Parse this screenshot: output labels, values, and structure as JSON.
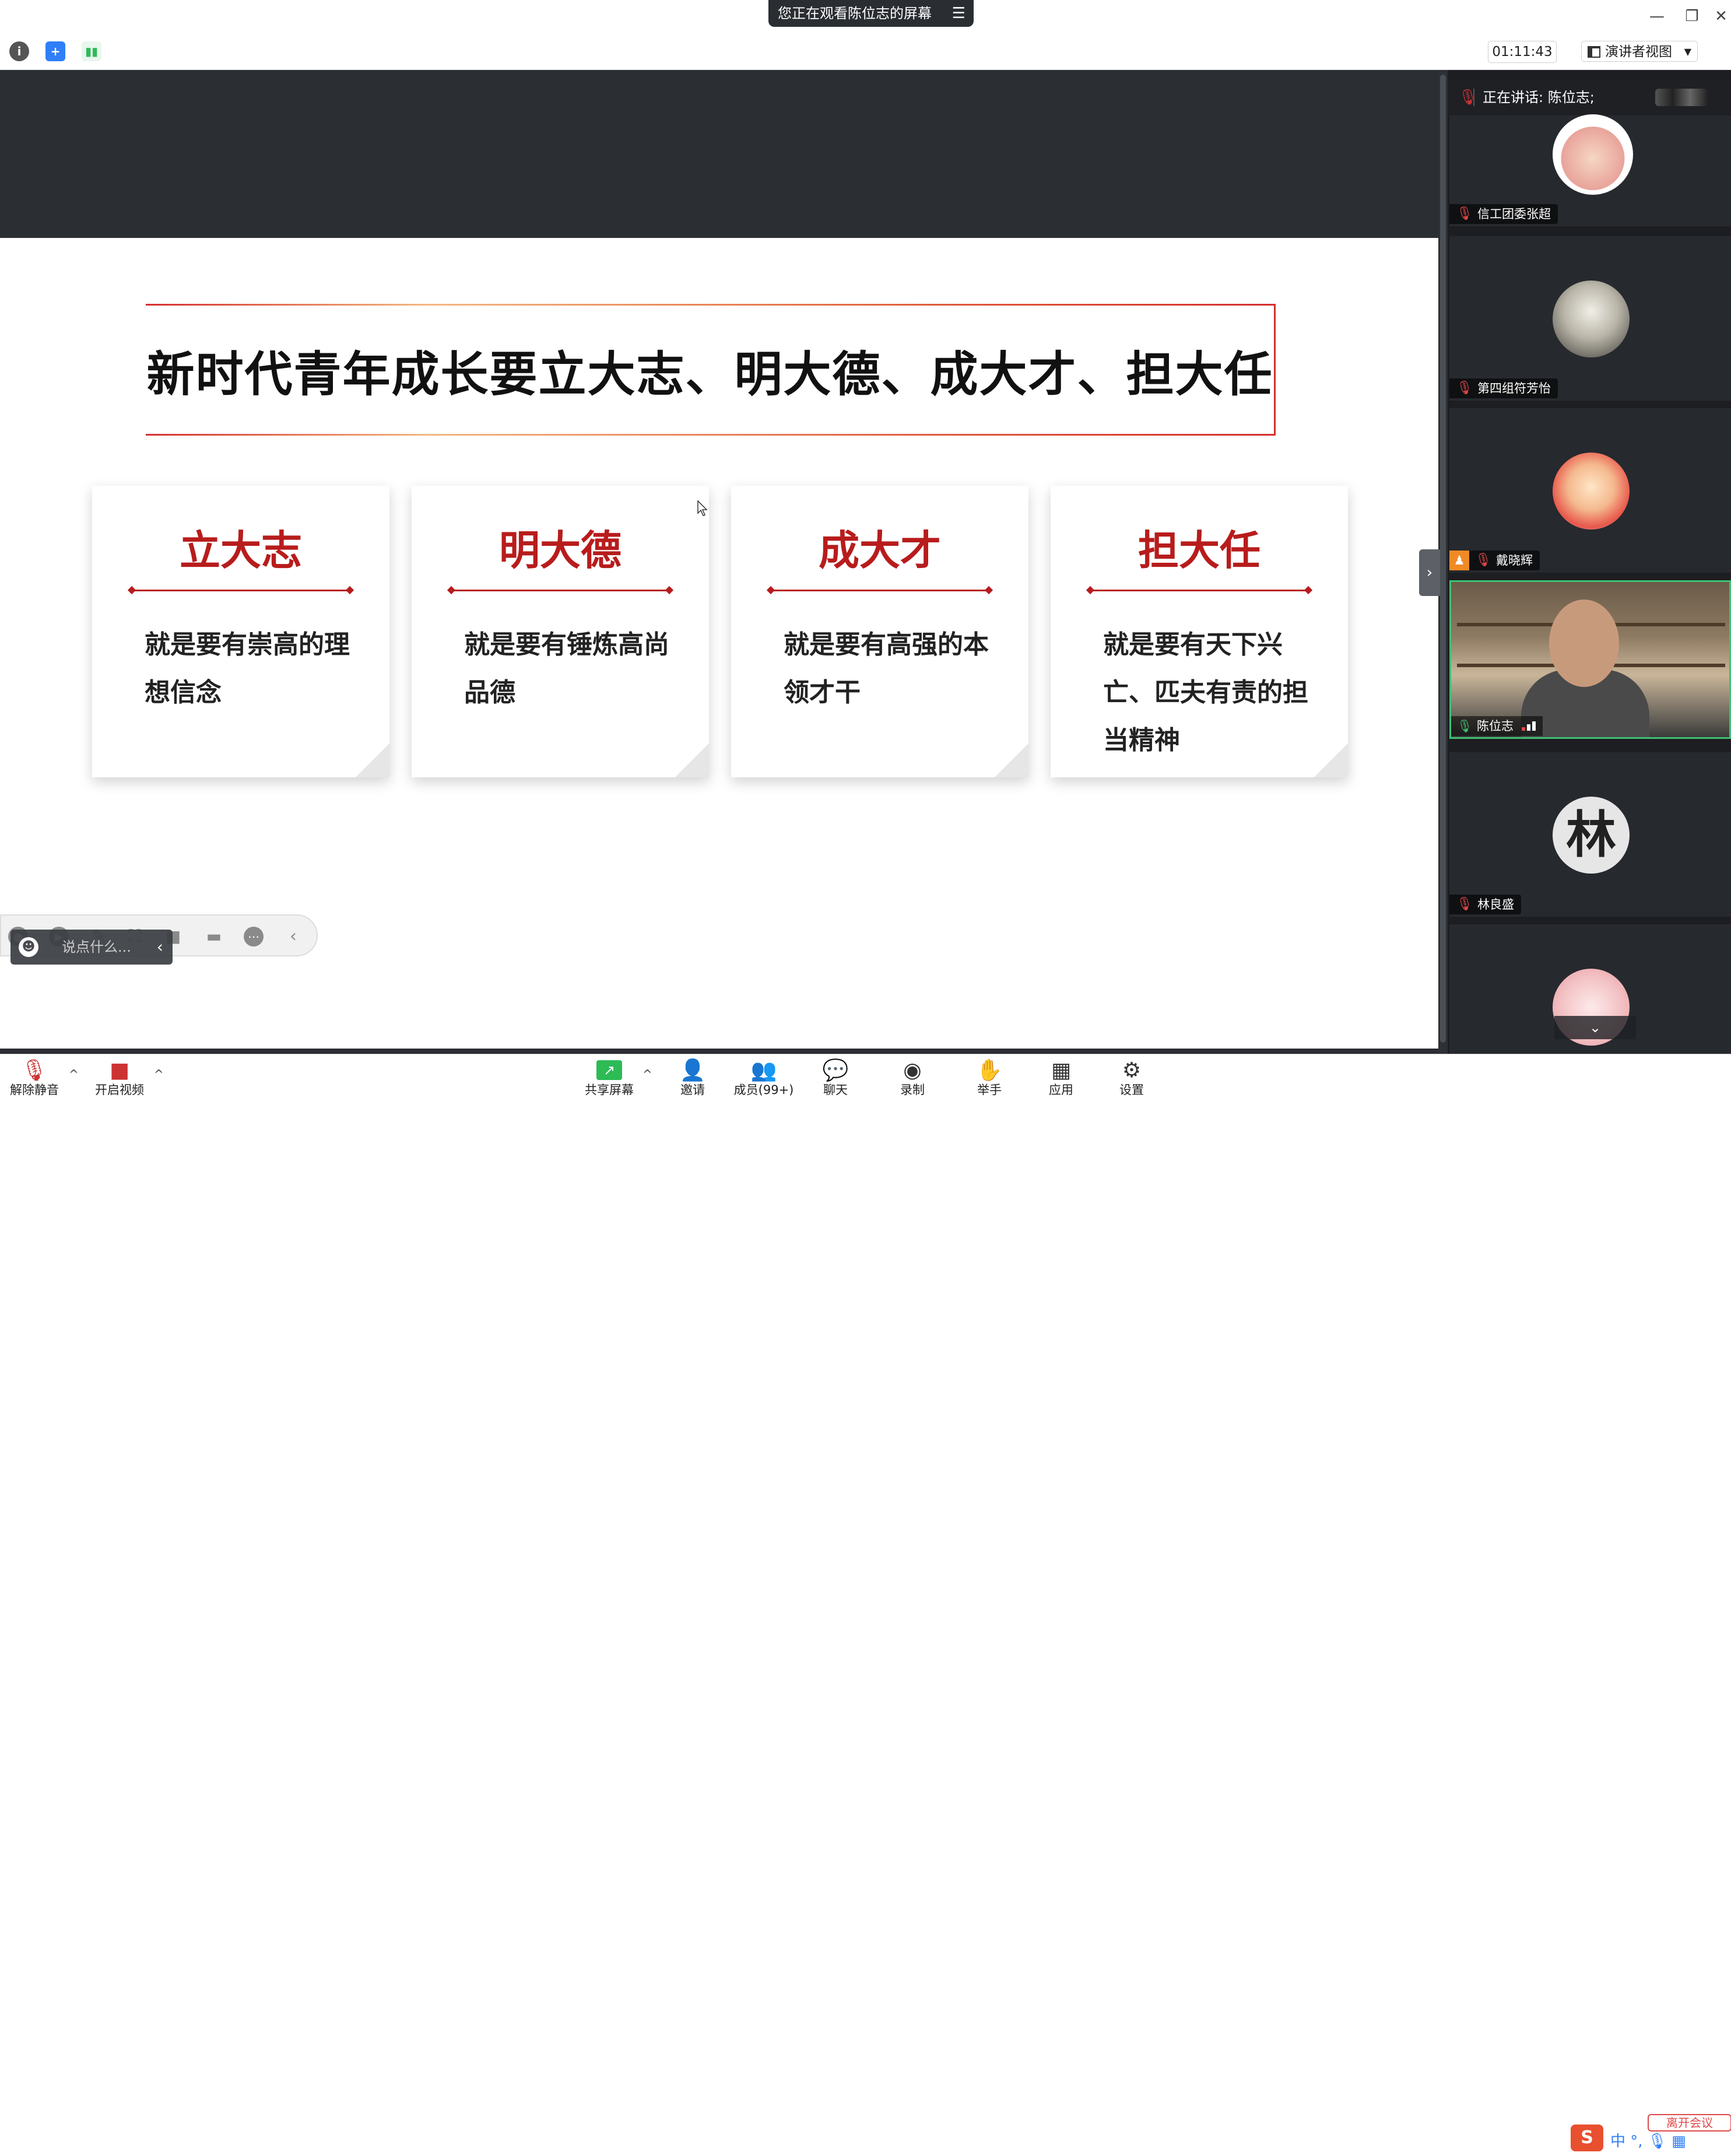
{
  "window": {
    "share_banner": "您正在观看陈位志的屏幕",
    "share_banner_menu_icon": "menu-icon",
    "controls": [
      "minimize-icon",
      "restore-icon",
      "close-icon"
    ]
  },
  "toolbar": {
    "timer": "01:11:43",
    "view_mode": "演讲者视图",
    "icons": [
      "info-icon",
      "security-shield-icon",
      "signal-stats-icon"
    ],
    "accent_green": "#2dbb56",
    "accent_blue": "#2f7ff6"
  },
  "slide": {
    "title": "新时代青年成长要立大志、明大德、成大才、担大任",
    "cards": [
      {
        "head": "立大志",
        "body": "就是要有崇高的理想信念"
      },
      {
        "head": "明大德",
        "body": "就是要有锤炼高尚品德"
      },
      {
        "head": "成大才",
        "body": "就是要有高强的本领才干"
      },
      {
        "head": "担大任",
        "body": "就是要有天下兴亡、匹夫有责的担当精神"
      }
    ],
    "title_color": "#111111",
    "accent_red": "#b81c1c"
  },
  "chat": {
    "placeholder": "说点什么..."
  },
  "panel": {
    "speaking": "正在讲话: 陈位志;",
    "participants": [
      {
        "name": "信工团委张超"
      },
      {
        "name": "第四组符芳怡"
      },
      {
        "name": "戴晓辉"
      },
      {
        "name": "陈位志"
      },
      {
        "name": "林良盛"
      },
      {
        "name": ""
      }
    ],
    "avatar_text_lin": "林",
    "active_border": "#3fc073"
  },
  "bottombar": {
    "buttons": [
      {
        "label": "解除静音",
        "icon": "microphone-muted-icon"
      },
      {
        "label": "开启视频",
        "icon": "video-off-icon"
      },
      {
        "label": "共享屏幕",
        "icon": "share-screen-icon"
      },
      {
        "label": "邀请",
        "icon": "invite-user-icon"
      },
      {
        "label": "成员(99+)",
        "icon": "participants-icon"
      },
      {
        "label": "聊天",
        "icon": "chat-icon"
      },
      {
        "label": "录制",
        "icon": "record-icon"
      },
      {
        "label": "举手",
        "icon": "raise-hand-icon"
      },
      {
        "label": "应用",
        "icon": "apps-icon"
      },
      {
        "label": "设置",
        "icon": "settings-icon"
      }
    ],
    "leave_label": "离开会议"
  }
}
